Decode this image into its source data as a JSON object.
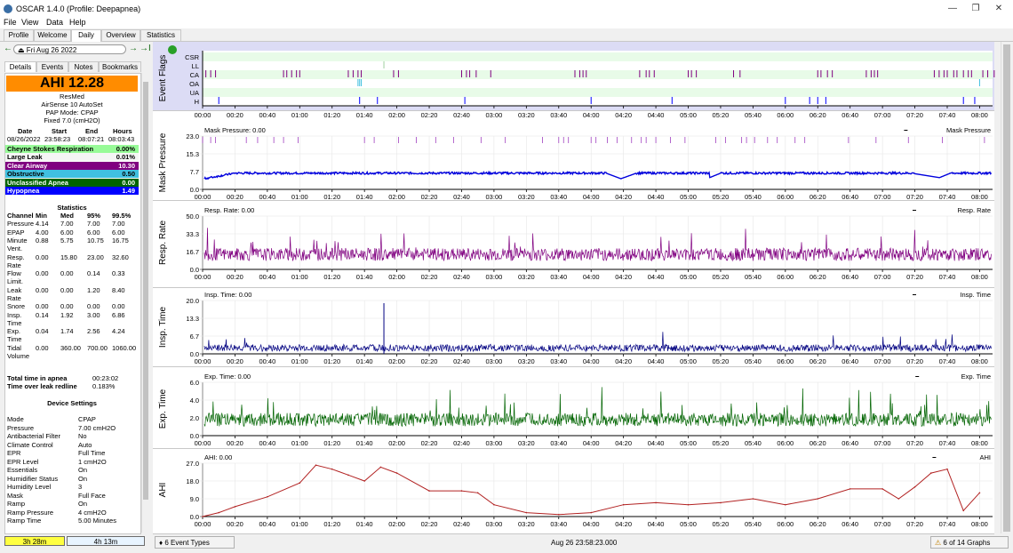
{
  "window": {
    "title": "OSCAR 1.4.0 (Profile: Deepapnea)",
    "min": "—",
    "max": "❐",
    "close": "✕"
  },
  "menu": [
    "File",
    "View",
    "Data",
    "Help"
  ],
  "tabs": [
    "Profile",
    "Welcome",
    "Daily",
    "Overview",
    "Statistics"
  ],
  "date_nav": {
    "prev": "←",
    "date": "Fri Aug 26 2022",
    "next": "→",
    "last": "→I"
  },
  "subtabs": [
    "Details",
    "Events",
    "Notes",
    "Bookmarks"
  ],
  "details": {
    "ahi": "AHI 12.28",
    "machine": [
      "ResMed",
      "AirSense 10 AutoSet",
      "PAP Mode: CPAP",
      "Fixed 7.0 (cmH2O)"
    ],
    "session_headers": [
      "Date",
      "Start",
      "End",
      "Hours"
    ],
    "session_values": [
      "08/26/2022",
      "23:58:23",
      "08:07:21",
      "08:03:43"
    ],
    "events": [
      {
        "label": "Cheyne Stokes Respiration",
        "value": "0.00%",
        "bg": "#98fb98",
        "fg": "#000000"
      },
      {
        "label": "Large Leak",
        "value": "0.01%",
        "bg": "#f5f5f5",
        "fg": "#000000"
      },
      {
        "label": "Clear Airway",
        "value": "10.30",
        "bg": "#800080",
        "fg": "#ffffff"
      },
      {
        "label": "Obstructive",
        "value": "0.50",
        "bg": "#40c0e0",
        "fg": "#000000"
      },
      {
        "label": "Unclassified Apnea",
        "value": "0.00",
        "bg": "#006400",
        "fg": "#ffffff"
      },
      {
        "label": "Hypopnea",
        "value": "1.49",
        "bg": "#0000ff",
        "fg": "#ffffff"
      }
    ],
    "stats_title": "Statistics",
    "stats_headers": [
      "Channel",
      "Min",
      "Med",
      "95%",
      "99.5%"
    ],
    "stats": [
      {
        "name": [
          "Pressure"
        ],
        "vals": [
          "4.14",
          "7.00",
          "7.00",
          "7.00"
        ]
      },
      {
        "name": [
          "EPAP"
        ],
        "vals": [
          "4.00",
          "6.00",
          "6.00",
          "6.00"
        ]
      },
      {
        "name": [
          "Minute",
          "Vent."
        ],
        "vals": [
          "0.88",
          "5.75",
          "10.75",
          "16.75"
        ]
      },
      {
        "name": [
          "Resp.",
          "Rate"
        ],
        "vals": [
          "0.00",
          "15.80",
          "23.00",
          "32.60"
        ]
      },
      {
        "name": [
          "Flow",
          "Limit."
        ],
        "vals": [
          "0.00",
          "0.00",
          "0.14",
          "0.33"
        ]
      },
      {
        "name": [
          "Leak",
          "Rate"
        ],
        "vals": [
          "0.00",
          "0.00",
          "1.20",
          "8.40"
        ]
      },
      {
        "name": [
          "Snore"
        ],
        "vals": [
          "0.00",
          "0.00",
          "0.00",
          "0.00"
        ]
      },
      {
        "name": [
          "Insp.",
          "Time"
        ],
        "vals": [
          "0.14",
          "1.92",
          "3.00",
          "6.86"
        ]
      },
      {
        "name": [
          "Exp.",
          "Time"
        ],
        "vals": [
          "0.04",
          "1.74",
          "2.56",
          "4.24"
        ]
      },
      {
        "name": [
          "Tidal",
          "Volume"
        ],
        "vals": [
          "0.00",
          "360.00",
          "700.00",
          "1060.00"
        ]
      }
    ],
    "totals": [
      {
        "label": "Total time in apnea",
        "value": "00:23:02"
      },
      {
        "label": "Time over leak redline",
        "value": "0.183%"
      }
    ],
    "device_title": "Device Settings",
    "device": [
      {
        "k": "Mode",
        "v": "CPAP"
      },
      {
        "k": "Pressure",
        "v": "7.00 cmH2O"
      },
      {
        "k": "Antibacterial Filter",
        "v": "No"
      },
      {
        "k": "Climate Control",
        "v": "Auto"
      },
      {
        "k": "EPR",
        "v": "Full Time"
      },
      {
        "k": "EPR Level",
        "v": "1 cmH2O"
      },
      {
        "k": "Essentials",
        "v": "On"
      },
      {
        "k": "Humidifier Status",
        "v": "On"
      },
      {
        "k": "Humidity Level",
        "v": "3"
      },
      {
        "k": "Mask",
        "v": "Full Face"
      },
      {
        "k": "Ramp",
        "v": "On"
      },
      {
        "k": "Ramp Pressure",
        "v": "4 cmH2O"
      },
      {
        "k": "Ramp Time",
        "v": "5.00 Minutes"
      }
    ]
  },
  "time_bar": {
    "left": "3h 28m",
    "right": "4h 13m"
  },
  "x_ticks": [
    "00:00",
    "00:20",
    "00:40",
    "01:00",
    "01:20",
    "01:40",
    "02:00",
    "02:20",
    "02:40",
    "03:00",
    "03:20",
    "03:40",
    "04:00",
    "04:20",
    "04:40",
    "05:00",
    "05:20",
    "05:40",
    "06:00",
    "06:20",
    "06:40",
    "07:00",
    "07:20",
    "07:40",
    "08:00"
  ],
  "chart_data": [
    {
      "type": "line",
      "title": "Event Flags",
      "ylabel": "Event Flags",
      "categories": [
        "CSR",
        "LL",
        "CA",
        "OA",
        "UA",
        "H"
      ],
      "colors": {
        "CA": "#800080",
        "OA": "#40c0e0",
        "H": "#0000ff",
        "LL": "#888888"
      }
    },
    {
      "type": "line",
      "title": "Mask Pressure: 0.00",
      "legend": "Mask Pressure",
      "ylabel": "Mask Pressure",
      "ylim": [
        0,
        23.0
      ],
      "yticks": [
        "23.0",
        "15.3",
        "7.7",
        "0.0"
      ],
      "color": "#0000dd",
      "series_color": "#0000dd"
    },
    {
      "type": "line",
      "title": "Resp. Rate: 0.00",
      "legend": "Resp. Rate",
      "ylabel": "Resp. Rate",
      "ylim": [
        0,
        50.0
      ],
      "yticks": [
        "50.0",
        "33.3",
        "16.7",
        "0.0"
      ],
      "color": "#800080"
    },
    {
      "type": "line",
      "title": "Insp. Time: 0.00",
      "legend": "Insp. Time",
      "ylabel": "Insp. Time",
      "ylim": [
        0,
        20.0
      ],
      "yticks": [
        "20.0",
        "13.3",
        "6.7",
        "0.0"
      ],
      "color": "#000080"
    },
    {
      "type": "line",
      "title": "Exp. Time: 0.00",
      "legend": "Exp. Time",
      "ylabel": "Exp. Time",
      "ylim": [
        0,
        6.0
      ],
      "yticks": [
        "6.0",
        "4.0",
        "2.0",
        "0.0"
      ],
      "color": "#006400"
    },
    {
      "type": "line",
      "title": "AHI: 0.00",
      "legend": "AHI",
      "ylabel": "AHI",
      "ylim": [
        0,
        27.0
      ],
      "yticks": [
        "27.0",
        "18.0",
        "9.0",
        "0.0"
      ],
      "color": "#b22222",
      "x": [
        "00:00",
        "00:10",
        "00:20",
        "00:40",
        "01:00",
        "01:10",
        "01:20",
        "01:30",
        "01:40",
        "01:50",
        "02:00",
        "02:20",
        "02:40",
        "02:50",
        "03:00",
        "03:20",
        "03:40",
        "04:00",
        "04:20",
        "04:40",
        "05:00",
        "05:20",
        "05:40",
        "06:00",
        "06:20",
        "06:40",
        "07:00",
        "07:10",
        "07:20",
        "07:30",
        "07:40",
        "07:50",
        "08:00"
      ],
      "values": [
        0,
        2,
        5,
        10,
        17,
        26,
        24,
        21,
        18,
        25,
        22,
        13,
        13,
        12,
        6,
        2,
        1,
        2,
        6,
        7,
        6,
        7,
        9,
        6,
        9,
        14,
        14,
        9,
        15,
        22,
        24,
        3,
        12
      ]
    }
  ],
  "status": {
    "event_types": "6 Event Types",
    "timestamp": "Aug 26 23:58:23.000",
    "graphs": "6 of 14 Graphs"
  }
}
